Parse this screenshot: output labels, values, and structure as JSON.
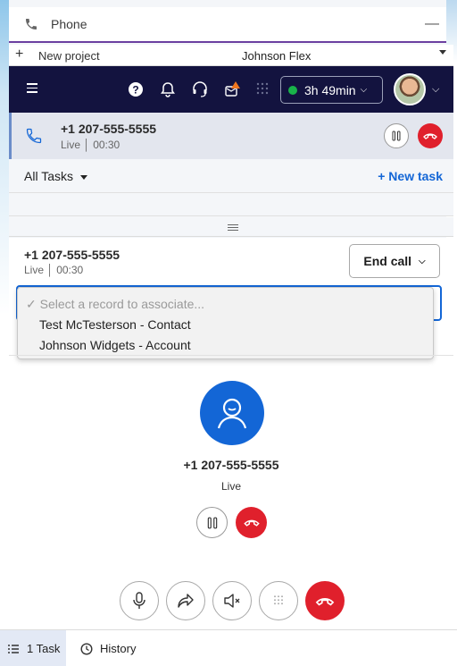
{
  "window": {
    "title": "Phone"
  },
  "project_bar": {
    "new_project": "New project",
    "account": "Johnson Flex"
  },
  "header": {
    "timer": "3h 49min"
  },
  "active_call": {
    "number": "+1 207-555-5555",
    "status": "Live",
    "duration": "00:30"
  },
  "tasks": {
    "filter": "All Tasks",
    "new_task": "+ New task"
  },
  "call_panel": {
    "number": "+1 207-555-5555",
    "status": "Live",
    "duration": "00:30",
    "end_call": "End call",
    "record_select": {
      "placeholder": "Select a record to associate...",
      "options": [
        "Test McTesterson - Contact",
        "Johnson Widgets - Account"
      ]
    },
    "contact_number": "+1 207-555-5555",
    "contact_status": "Live"
  },
  "bottom_bar": {
    "tasks_tab": "1 Task",
    "history_tab": "History"
  },
  "colors": {
    "accent": "#1366d6",
    "header": "#13133f",
    "hangup": "#e0202c",
    "live_dot": "#19b34a"
  }
}
